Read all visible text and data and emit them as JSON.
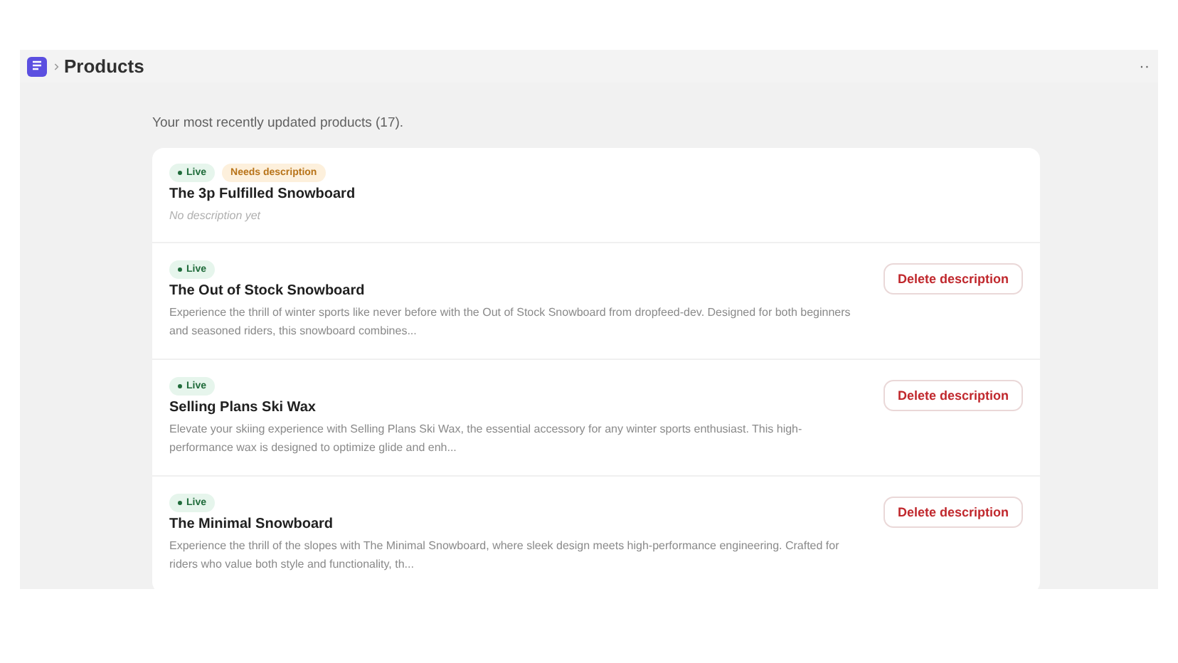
{
  "header": {
    "title": "Products",
    "menu": "··"
  },
  "intro": "Your most recently updated products (17).",
  "products": [
    {
      "badges": [
        {
          "kind": "live",
          "label": "Live"
        },
        {
          "kind": "warning",
          "label": "Needs description"
        }
      ],
      "title": "The 3p Fulfilled Snowboard",
      "description": "No description yet",
      "has_description": false
    },
    {
      "badges": [
        {
          "kind": "live",
          "label": "Live"
        }
      ],
      "title": "The Out of Stock Snowboard",
      "description": "Experience the thrill of winter sports like never before with the Out of Stock Snowboard from dropfeed-dev. Designed for both beginners and seasoned riders, this snowboard combines...",
      "has_description": true,
      "action": "Delete description"
    },
    {
      "badges": [
        {
          "kind": "live",
          "label": "Live"
        }
      ],
      "title": "Selling Plans Ski Wax",
      "description": "Elevate your skiing experience with Selling Plans Ski Wax, the essential accessory for any winter sports enthusiast. This high-performance wax is designed to optimize glide and enh...",
      "has_description": true,
      "action": "Delete description"
    },
    {
      "badges": [
        {
          "kind": "live",
          "label": "Live"
        }
      ],
      "title": "The Minimal Snowboard",
      "description": "Experience the thrill of the slopes with The Minimal Snowboard, where sleek design meets high-performance engineering. Crafted for riders who value both style and functionality, th...",
      "has_description": true,
      "action": "Delete description"
    }
  ]
}
